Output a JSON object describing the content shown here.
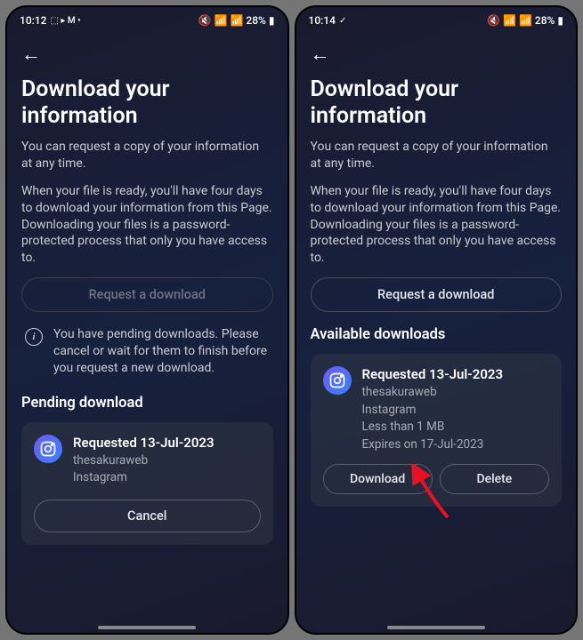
{
  "left": {
    "status": {
      "time": "10:12",
      "icons": "⬛ ⯈ M •",
      "battery": "28%",
      "signals": "🔇 📶 ⚡"
    },
    "title": "Download your information",
    "p1": "You can request a copy of your information at any time.",
    "p2": "When your file is ready, you'll have four days to download your information from this Page. Downloading your files is a password-protected process that only you have access to.",
    "request_btn": "Request a download",
    "info_msg": "You have pending downloads. Please cancel or wait for them to finish before you request a new download.",
    "section": "Pending download",
    "card": {
      "title": "Requested 13-Jul-2023",
      "user": "thesakuraweb",
      "app": "Instagram",
      "cancel": "Cancel"
    }
  },
  "right": {
    "status": {
      "time": "10:14",
      "icons": "✓",
      "battery": "28%"
    },
    "title": "Download your information",
    "p1": "You can request a copy of your information at any time.",
    "p2": "When your file is ready, you'll have four days to download your information from this Page. Downloading your files is a password-protected process that only you have access to.",
    "request_btn": "Request a download",
    "section": "Available downloads",
    "card": {
      "title": "Requested 13-Jul-2023",
      "user": "thesakuraweb",
      "app": "Instagram",
      "size": "Less than 1 MB",
      "expires": "Expires on 17-Jul-2023",
      "download": "Download",
      "delete": "Delete"
    }
  }
}
